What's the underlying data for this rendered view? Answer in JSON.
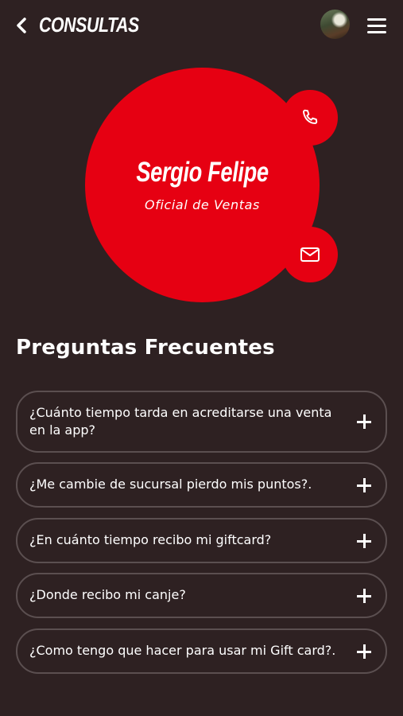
{
  "header": {
    "title": "CONSULTAS",
    "back_icon": "chevron-left-icon",
    "menu_icon": "hamburger-menu-icon"
  },
  "profile": {
    "name": "Sergio Felipe",
    "role": "Oficial de Ventas",
    "call_icon": "phone-icon",
    "mail_icon": "mail-icon"
  },
  "faq": {
    "title": "Preguntas Frecuentes",
    "items": [
      {
        "question": "¿Cuánto tiempo tarda en acreditarse una venta en la app?"
      },
      {
        "question": "¿Me cambie de sucursal pierdo mis puntos?."
      },
      {
        "question": "¿En cuánto tiempo recibo mi giftcard?"
      },
      {
        "question": "¿Donde recibo mi canje?"
      },
      {
        "question": "¿Como tengo que hacer para usar mi Gift card?."
      }
    ]
  },
  "colors": {
    "background": "#2e2122",
    "accent": "#e60012",
    "border": "#5b4f50",
    "text": "#ffffff"
  }
}
